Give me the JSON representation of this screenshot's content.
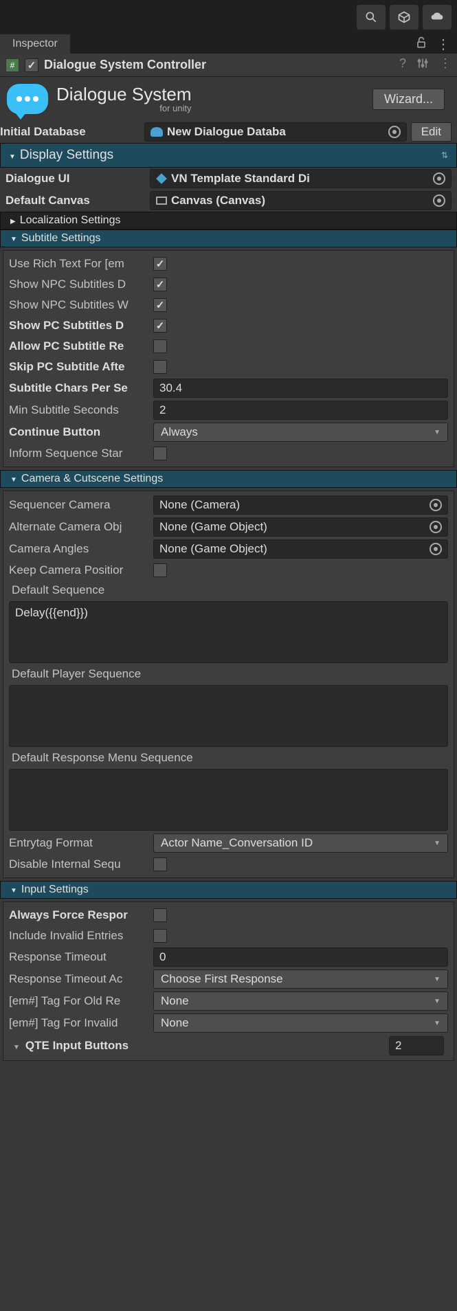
{
  "tab": {
    "name": "Inspector"
  },
  "component": {
    "title": "Dialogue System Controller"
  },
  "logo": {
    "title": "Dialogue System",
    "subtitle": "for unity"
  },
  "wizard_btn": "Wizard...",
  "initial_db": {
    "label": "Initial Database",
    "value": "New Dialogue Databa",
    "edit": "Edit"
  },
  "display_settings": {
    "title": "Display Settings"
  },
  "dialogue_ui": {
    "label": "Dialogue UI",
    "value": "VN Template Standard Di"
  },
  "default_canvas": {
    "label": "Default Canvas",
    "value": "Canvas (Canvas)"
  },
  "localization": {
    "title": "Localization Settings"
  },
  "subtitle_settings": {
    "title": "Subtitle Settings",
    "use_rich_text": {
      "label": "Use Rich Text For [em",
      "value": true
    },
    "show_npc_d": {
      "label": "Show NPC Subtitles D",
      "value": true
    },
    "show_npc_w": {
      "label": "Show NPC Subtitles W",
      "value": true
    },
    "show_pc_d": {
      "label": "Show PC Subtitles D",
      "value": true
    },
    "allow_pc_rem": {
      "label": "Allow PC Subtitle Re",
      "value": false
    },
    "skip_pc_after": {
      "label": "Skip PC Subtitle Afte",
      "value": false
    },
    "chars_per_sec": {
      "label": "Subtitle Chars Per Se",
      "value": "30.4"
    },
    "min_seconds": {
      "label": "Min Subtitle Seconds",
      "value": "2"
    },
    "continue_btn": {
      "label": "Continue Button",
      "value": "Always"
    },
    "inform_seq": {
      "label": "Inform Sequence Star",
      "value": false
    }
  },
  "camera_settings": {
    "title": "Camera & Cutscene Settings",
    "seq_camera": {
      "label": "Sequencer Camera",
      "value": "None (Camera)"
    },
    "alt_camera": {
      "label": "Alternate Camera Obj",
      "value": "None (Game Object)"
    },
    "camera_angles": {
      "label": "Camera Angles",
      "value": "None (Game Object)"
    },
    "keep_pos": {
      "label": "Keep Camera Positior",
      "value": false
    },
    "default_seq": {
      "label": "Default Sequence",
      "value": "Delay({{end}})"
    },
    "default_player_seq": {
      "label": "Default Player Sequence",
      "value": ""
    },
    "default_response_seq": {
      "label": "Default Response Menu Sequence",
      "value": ""
    },
    "entrytag": {
      "label": "Entrytag Format",
      "value": "Actor Name_Conversation ID"
    },
    "disable_internal": {
      "label": "Disable Internal Sequ",
      "value": false
    }
  },
  "input_settings": {
    "title": "Input Settings",
    "always_force": {
      "label": "Always Force Respor",
      "value": false
    },
    "include_invalid": {
      "label": "Include Invalid Entries",
      "value": false
    },
    "response_timeout": {
      "label": "Response Timeout",
      "value": "0"
    },
    "response_timeout_ac": {
      "label": "Response Timeout Ac",
      "value": "Choose First Response"
    },
    "em_old": {
      "label": "[em#] Tag For Old Re",
      "value": "None"
    },
    "em_invalid": {
      "label": "[em#] Tag For Invalid",
      "value": "None"
    },
    "qte": {
      "label": "QTE Input Buttons",
      "value": "2"
    }
  }
}
